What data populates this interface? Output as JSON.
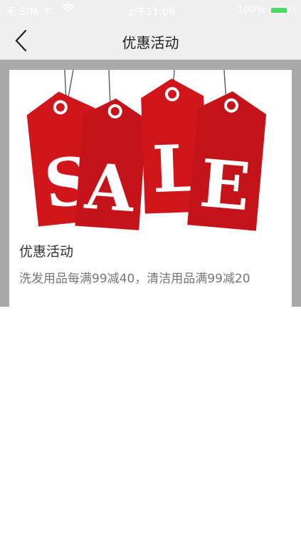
{
  "status_bar": {
    "carrier": "无 SIM 卡",
    "time": "上午11:06",
    "battery": "100%"
  },
  "nav": {
    "title": "优惠活动"
  },
  "promo": {
    "banner_text": "SALE",
    "title": "优惠活动",
    "description": "洗发用品每满99减40，清洁用品满99减20"
  },
  "colors": {
    "tag_red": "#d0161b",
    "battery_green": "#4cd964"
  }
}
